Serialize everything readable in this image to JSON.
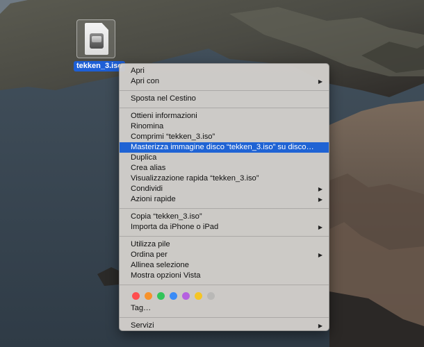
{
  "desktop": {
    "file": {
      "name": "tekken_3.iso",
      "icon": "disk-image-file-icon"
    }
  },
  "menu": {
    "group1": [
      {
        "label": "Apri"
      },
      {
        "label": "Apri con",
        "submenu": true
      }
    ],
    "group2": [
      {
        "label": "Sposta nel Cestino"
      }
    ],
    "group3": [
      {
        "label": "Ottieni informazioni"
      },
      {
        "label": "Rinomina"
      },
      {
        "label": "Comprimi “tekken_3.iso”"
      },
      {
        "label": "Masterizza immagine disco “tekken_3.iso” su disco…",
        "highlighted": true
      },
      {
        "label": "Duplica"
      },
      {
        "label": "Crea alias"
      },
      {
        "label": "Visualizzazione rapida “tekken_3.iso”"
      },
      {
        "label": "Condividi",
        "submenu": true
      },
      {
        "label": "Azioni rapide",
        "submenu": true
      }
    ],
    "group4": [
      {
        "label": "Copia “tekken_3.iso”"
      },
      {
        "label": "Importa da iPhone o iPad",
        "submenu": true
      }
    ],
    "group5": [
      {
        "label": "Utilizza pile"
      },
      {
        "label": "Ordina per",
        "submenu": true
      },
      {
        "label": "Allinea selezione"
      },
      {
        "label": "Mostra opzioni Vista"
      }
    ],
    "tag_colors": [
      "#ff4d4f",
      "#f7922b",
      "#33c45a",
      "#3a8bf6",
      "#b561e0",
      "#f5c525",
      "#a9a9a9"
    ],
    "tags_label": "Tag…",
    "group6": [
      {
        "label": "Servizi",
        "submenu": true
      }
    ],
    "submenu_glyph": "▶",
    "accent_color": "#1f63d4"
  }
}
